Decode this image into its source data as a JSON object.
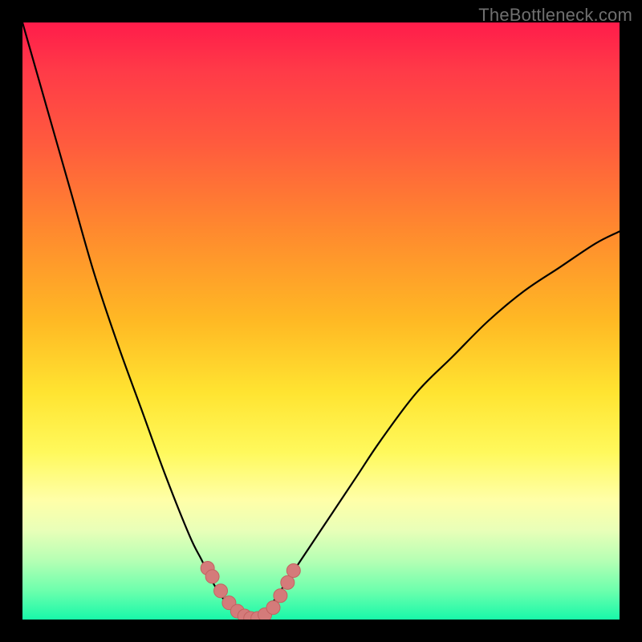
{
  "watermark": {
    "text": "TheBottleneck.com"
  },
  "colors": {
    "curve_stroke": "#000000",
    "dot_fill": "#d47b7a",
    "dot_stroke": "#c36261",
    "bg_black": "#000000"
  },
  "chart_data": {
    "type": "line",
    "title": "",
    "xlabel": "",
    "ylabel": "",
    "xlim": [
      0,
      100
    ],
    "ylim": [
      0,
      100
    ],
    "grid": false,
    "x": [
      0,
      4,
      8,
      12,
      16,
      20,
      24,
      28,
      30,
      32,
      34,
      36,
      38,
      40,
      42,
      44,
      48,
      52,
      56,
      60,
      66,
      72,
      78,
      84,
      90,
      96,
      100
    ],
    "series": [
      {
        "name": "left-branch",
        "type": "line",
        "x": [
          0,
          4,
          8,
          12,
          16,
          20,
          24,
          28,
          30,
          32,
          34,
          36,
          38
        ],
        "values": [
          100,
          86,
          72,
          58,
          46,
          35,
          24,
          14,
          10,
          6,
          3,
          1,
          0
        ]
      },
      {
        "name": "valley-floor",
        "type": "line",
        "x": [
          36,
          38,
          40
        ],
        "values": [
          1,
          0,
          1
        ]
      },
      {
        "name": "right-branch",
        "type": "line",
        "x": [
          40,
          42,
          44,
          48,
          52,
          56,
          60,
          66,
          72,
          78,
          84,
          90,
          96,
          100
        ],
        "values": [
          1,
          3,
          6,
          12,
          18,
          24,
          30,
          38,
          44,
          50,
          55,
          59,
          63,
          65
        ]
      },
      {
        "name": "markers-left",
        "type": "scatter",
        "x": [
          31.0,
          31.8,
          33.2,
          34.6,
          36.0,
          37.2,
          38.2
        ],
        "values": [
          8.6,
          7.2,
          4.8,
          2.8,
          1.4,
          0.6,
          0.2
        ]
      },
      {
        "name": "markers-right",
        "type": "scatter",
        "x": [
          39.4,
          40.6,
          42.0,
          43.2,
          44.4,
          45.4
        ],
        "values": [
          0.2,
          0.8,
          2.0,
          4.0,
          6.2,
          8.2
        ]
      }
    ],
    "annotations": [
      {
        "text": "TheBottleneck.com",
        "pos": "top-right"
      }
    ]
  }
}
